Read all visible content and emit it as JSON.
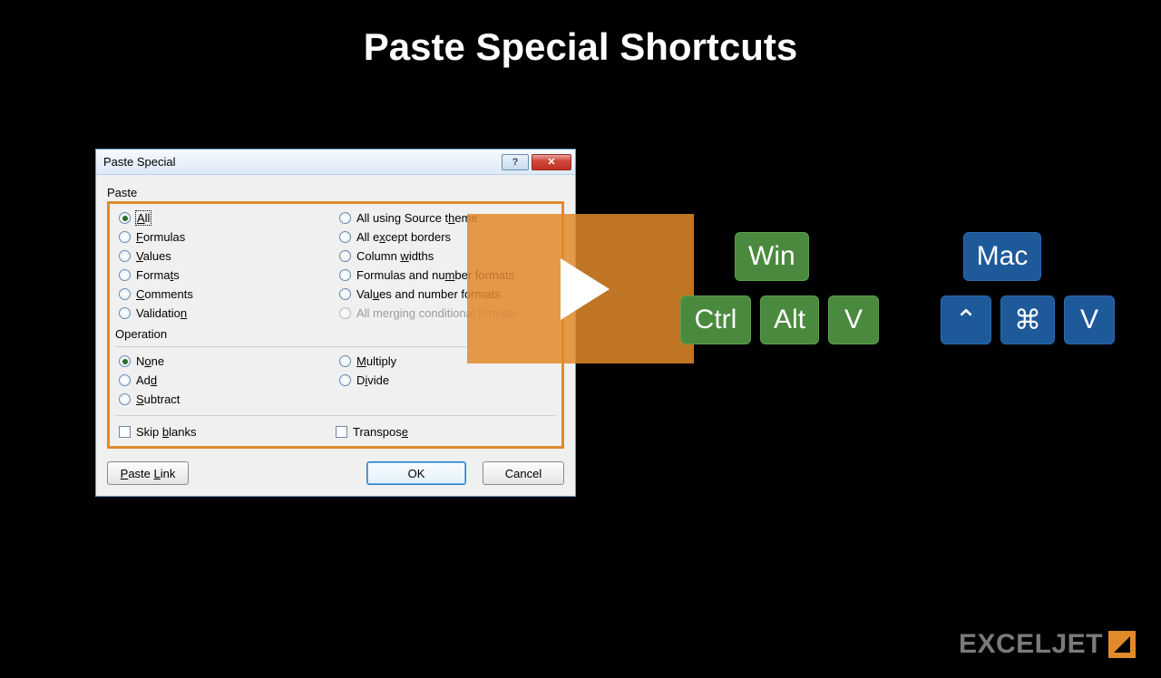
{
  "title": "Paste Special Shortcuts",
  "dialog": {
    "title": "Paste Special",
    "help_symbol": "?",
    "close_symbol": "✕",
    "paste_label": "Paste",
    "paste_left": [
      {
        "label": "All",
        "underline": "A",
        "selected": true,
        "focused": true
      },
      {
        "label": "Formulas",
        "underline": "F"
      },
      {
        "label": "Values",
        "underline": "V"
      },
      {
        "label": "Formats",
        "underline": "t",
        "pre": "Forma",
        "post": "s"
      },
      {
        "label": "Comments",
        "underline": "C"
      },
      {
        "label": "Validation",
        "underline": "n",
        "pre": "Validatio",
        "post": ""
      }
    ],
    "paste_right": [
      {
        "label": "All using Source theme",
        "underline": "h",
        "pre": "All using Source t",
        "post": "eme"
      },
      {
        "label": "All except borders",
        "underline": "x",
        "pre": "All e",
        "post": "cept borders"
      },
      {
        "label": "Column widths",
        "underline": "w",
        "pre": "Column ",
        "post": "idths"
      },
      {
        "label": "Formulas and number formats",
        "underline": "m",
        "pre": "Formulas and nu",
        "post": "ber formats"
      },
      {
        "label": "Values and number formats",
        "underline": "u",
        "pre": "Val",
        "post": "es and number formats"
      },
      {
        "label": "All merging conditional formats",
        "disabled": true
      }
    ],
    "op_label": "Operation",
    "op_left": [
      {
        "label": "None",
        "underline": "o",
        "pre": "N",
        "post": "ne",
        "selected": true
      },
      {
        "label": "Add",
        "underline": "d",
        "pre": "Ad",
        "post": ""
      },
      {
        "label": "Subtract",
        "underline": "S"
      }
    ],
    "op_right": [
      {
        "label": "Multiply",
        "underline": "M"
      },
      {
        "label": "Divide",
        "underline": "i",
        "pre": "D",
        "post": "vide"
      }
    ],
    "skip_blanks": "Skip blanks",
    "skip_u": "b",
    "skip_pre": "Skip ",
    "skip_post": "lanks",
    "transpose": "Transpose",
    "trans_u": "e",
    "trans_pre": "Transpos",
    "trans_post": "",
    "paste_link": "Paste Link",
    "ok": "OK",
    "cancel": "Cancel"
  },
  "shortcuts": {
    "win_label": "Win",
    "mac_label": "Mac",
    "win_keys": [
      "Ctrl",
      "Alt",
      "V"
    ],
    "mac_keys": [
      "⌃",
      "⌘",
      "V"
    ]
  },
  "logo": "EXCELJET"
}
